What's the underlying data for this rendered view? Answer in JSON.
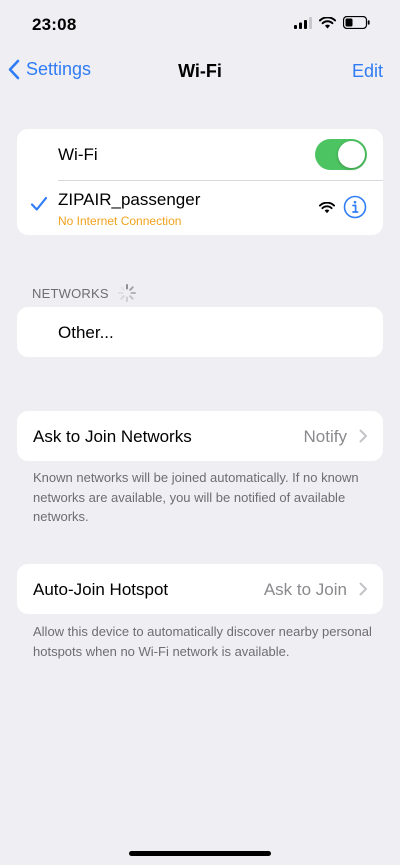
{
  "status_bar": {
    "time": "23:08"
  },
  "nav": {
    "back_label": "Settings",
    "title": "Wi-Fi",
    "edit_label": "Edit"
  },
  "wifi": {
    "toggle_label": "Wi-Fi",
    "enabled": true,
    "connected_network": {
      "name": "ZIPAIR_passenger",
      "status": "No Internet Connection"
    }
  },
  "networks": {
    "header": "NETWORKS",
    "other_label": "Other..."
  },
  "ask_to_join": {
    "label": "Ask to Join Networks",
    "value": "Notify",
    "footnote": "Known networks will be joined automatically. If no known networks are available, you will be notified of available networks."
  },
  "auto_join_hotspot": {
    "label": "Auto-Join Hotspot",
    "value": "Ask to Join",
    "footnote": "Allow this device to automatically discover nearby personal hotspots when no Wi-Fi network is available."
  },
  "colors": {
    "accent": "#2f7cf6",
    "toggle_on": "#4dc462",
    "warning": "#f0a21e",
    "background": "#eeeef3"
  },
  "icons": [
    "cellular-signal-icon",
    "wifi-icon",
    "battery-icon",
    "chevron-left-icon",
    "checkmark-icon",
    "wifi-strength-icon",
    "info-icon",
    "loading-spinner-icon",
    "chevron-right-icon"
  ]
}
